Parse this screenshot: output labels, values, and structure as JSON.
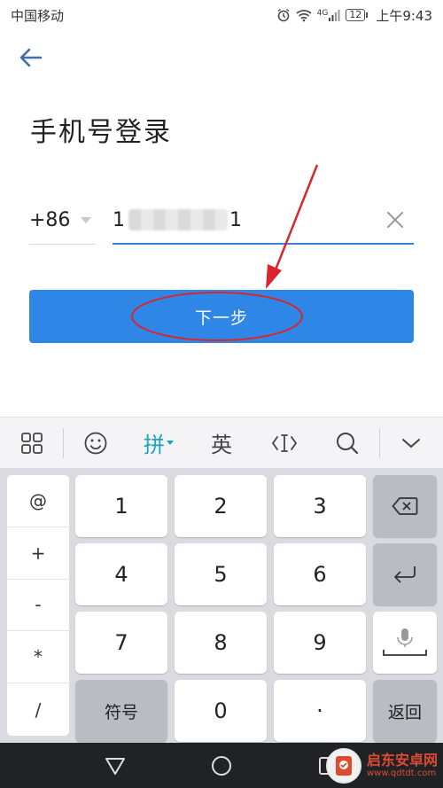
{
  "status_bar": {
    "carrier": "中国移动",
    "network": "4G",
    "battery": "12",
    "time": "上午9:43"
  },
  "header": {
    "back_icon": "arrow-left-icon",
    "title": "手机号登录"
  },
  "login_form": {
    "country_code": "+86",
    "phone_prefix": "1",
    "phone_suffix": "1",
    "clear_icon": "close-icon",
    "next_label": "下一步"
  },
  "annotation": {
    "color": "#d9262c"
  },
  "keyboard": {
    "toolbar": {
      "pinyin_label": "拼",
      "english_label": "英",
      "active_color": "#1ba2c0",
      "items": [
        "grid-icon",
        "emoji-icon",
        "pinyin-mode",
        "english-mode",
        "cursor-icon",
        "search-icon",
        "collapse-chevron-icon"
      ]
    },
    "symbol_keys": [
      "@",
      "+",
      "-",
      "*",
      "/"
    ],
    "digit_rows": [
      [
        "1",
        "2",
        "3"
      ],
      [
        "4",
        "5",
        "6"
      ],
      [
        "7",
        "8",
        "9"
      ]
    ],
    "bottom_row": {
      "symbol_label": "符号",
      "zero_label": "0",
      "dot_label": "·",
      "return_label": "返回"
    }
  },
  "watermark": {
    "name": "启东安卓网",
    "url": "www.qdtdt.com"
  }
}
